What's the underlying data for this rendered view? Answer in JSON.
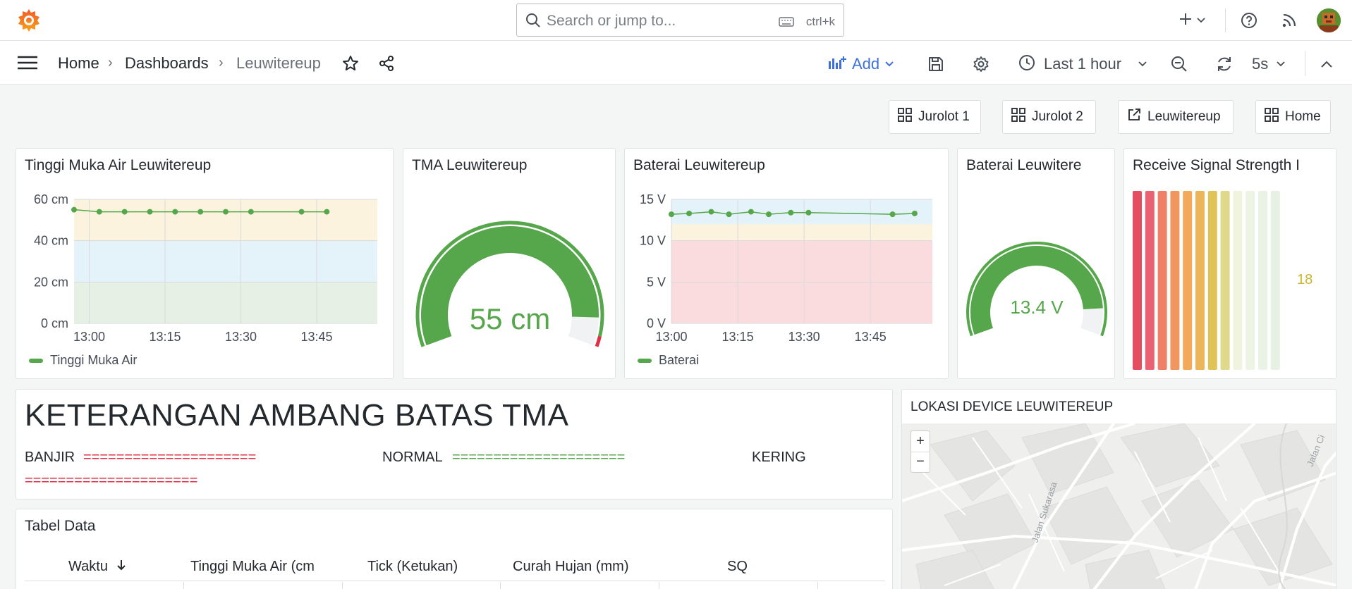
{
  "topbar": {
    "search_placeholder": "Search or jump to...",
    "search_shortcut": "ctrl+k"
  },
  "breadcrumb": {
    "home": "Home",
    "dashboards": "Dashboards",
    "current": "Leuwitereup"
  },
  "toolbar": {
    "add_label": "Add",
    "time_range": "Last 1 hour",
    "refresh_interval": "5s"
  },
  "links": [
    {
      "label": "Jurolot 1",
      "icon": "apps-icon"
    },
    {
      "label": "Jurolot 2",
      "icon": "apps-icon"
    },
    {
      "label": "Leuwitereup",
      "icon": "external-link-icon"
    },
    {
      "label": "Home",
      "icon": "apps-icon"
    }
  ],
  "panels": {
    "tma_timeseries": {
      "title": "Tinggi Muka Air Leuwitereup",
      "legend": "Tinggi Muka Air"
    },
    "tma_gauge": {
      "title": "TMA Leuwitereup",
      "value_text": "55 cm",
      "value": 55,
      "min": 0,
      "max": 60
    },
    "baterai_timeseries": {
      "title": "Baterai Leuwitereup",
      "legend": "Baterai"
    },
    "baterai_gauge": {
      "title": "Baterai Leuwitere",
      "value_text": "13.4 V",
      "value": 13.4,
      "min": 0,
      "max": 15
    },
    "signal": {
      "title": "Receive Signal Strength I",
      "value_text": "18",
      "value": 18,
      "max": 31
    },
    "keterangan": {
      "heading": "KETERANGAN AMBANG BATAS TMA",
      "banjir_label": "BANJIR",
      "banjir_line": "=====================",
      "normal_label": "NORMAL",
      "normal_line": "=====================",
      "kering_label": "KERING",
      "kering_line": "====================="
    },
    "map": {
      "title": "LOKASI DEVICE LEUWITEREUP",
      "zoom_in": "+",
      "zoom_out": "−",
      "street1": "Jalan Sukarasa",
      "street2": "Jalan Ci"
    },
    "table": {
      "title": "Tabel Data",
      "columns": [
        "Waktu",
        "Tinggi Muka Air (cm",
        "Tick (Ketukan)",
        "Curah Hujan (mm)",
        "SQ"
      ]
    }
  },
  "colors": {
    "green": "#56a64b",
    "red": "#e02f44",
    "blue_accent": "#3d71d9"
  },
  "chart_data": [
    {
      "type": "line",
      "name": "tma",
      "x": [
        "12:57",
        "13:02",
        "13:07",
        "13:12",
        "13:17",
        "13:22",
        "13:27",
        "13:32",
        "13:42",
        "13:47"
      ],
      "series": [
        {
          "name": "Tinggi Muka Air",
          "values": [
            55,
            54,
            54,
            54,
            54,
            54,
            54,
            54,
            54,
            54
          ]
        }
      ],
      "x_ticks": [
        "13:00",
        "13:15",
        "13:30",
        "13:45"
      ],
      "y_ticks": [
        "0 cm",
        "20 cm",
        "40 cm",
        "60 cm"
      ],
      "ylim": [
        0,
        60
      ],
      "thresholds": [
        {
          "from": 0,
          "to": 20,
          "color": "#e6f0e4"
        },
        {
          "from": 20,
          "to": 40,
          "color": "#e4f3fa"
        },
        {
          "from": 40,
          "to": 60,
          "color": "#fbf3de"
        }
      ],
      "grid": true,
      "legend_placement": "bottom-left"
    },
    {
      "type": "line",
      "name": "baterai",
      "x": [
        "13:00",
        "13:04",
        "13:09",
        "13:13",
        "13:18",
        "13:22",
        "13:27",
        "13:31",
        "13:50",
        "13:55"
      ],
      "series": [
        {
          "name": "Baterai",
          "values": [
            13.2,
            13.3,
            13.5,
            13.2,
            13.5,
            13.2,
            13.4,
            13.4,
            13.2,
            13.3
          ]
        }
      ],
      "x_ticks": [
        "13:00",
        "13:15",
        "13:30",
        "13:45"
      ],
      "y_ticks": [
        "0 V",
        "5 V",
        "10 V",
        "15 V"
      ],
      "ylim": [
        0,
        15
      ],
      "thresholds": [
        {
          "from": 0,
          "to": 10,
          "color": "#fadcdf"
        },
        {
          "from": 10,
          "to": 12,
          "color": "#fbf3de"
        },
        {
          "from": 12,
          "to": 15,
          "color": "#e4f3fa"
        }
      ],
      "grid": true,
      "legend_placement": "bottom-left"
    }
  ]
}
